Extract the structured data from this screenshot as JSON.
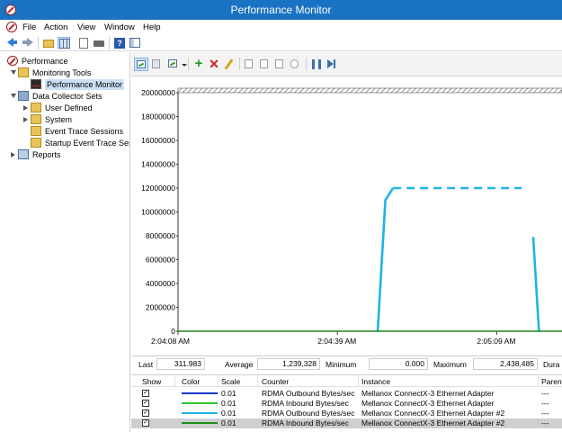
{
  "window": {
    "title": "Performance Monitor"
  },
  "menu": [
    "File",
    "Action",
    "View",
    "Window",
    "Help"
  ],
  "tree": {
    "root": "Performance",
    "monitoring_tools": "Monitoring Tools",
    "performance_monitor": "Performance Monitor",
    "data_collector_sets": "Data Collector Sets",
    "user_defined": "User Defined",
    "system": "System",
    "event_trace_sessions": "Event Trace Sessions",
    "startup_event_trace": "Startup Event Trace Ses",
    "reports": "Reports"
  },
  "chart_data": {
    "type": "line",
    "y_ticks": [
      "20000000",
      "18000000",
      "16000000",
      "14000000",
      "12000000",
      "10000000",
      "8000000",
      "6000000",
      "4000000",
      "2000000",
      "0"
    ],
    "ylim": [
      0,
      20000000
    ],
    "x_ticks": [
      "2:04:08 AM",
      "2:04:39 AM",
      "2:05:09 AM"
    ],
    "series": [
      {
        "name": "RDMA Inbound Bytes/sec",
        "color": "#1eb4e6",
        "style": "solid",
        "points": [
          [
            0.52,
            0
          ],
          [
            0.54,
            11000000
          ],
          [
            0.56,
            12000000
          ]
        ]
      },
      {
        "name": "RDMA Inbound Bytes/sec",
        "color": "#1eb4e6",
        "style": "dashed",
        "points": [
          [
            0.56,
            12000000
          ],
          [
            0.895,
            12000000
          ]
        ]
      },
      {
        "name": "RDMA Inbound Bytes/sec",
        "color": "#1eb4e6",
        "style": "solid",
        "points": [
          [
            0.925,
            7900000
          ],
          [
            0.94,
            0
          ]
        ]
      },
      {
        "name": "RDMA Inbound Bytes/sec #2",
        "color": "#1a8c1a",
        "style": "solid",
        "points": [
          [
            0,
            0
          ],
          [
            1,
            0
          ]
        ]
      }
    ]
  },
  "stats": {
    "last_label": "Last",
    "last_value": "311.983",
    "average_label": "Average",
    "average_value": "1,239,328",
    "minimum_label": "Minimum",
    "minimum_value": "0.000",
    "maximum_label": "Maximum",
    "maximum_value": "2,438,485",
    "duration_label": "Dura"
  },
  "legend": {
    "headers": {
      "show": "Show",
      "color": "Color",
      "scale": "Scale",
      "counter": "Counter",
      "instance": "Instance",
      "parent": "Parent"
    },
    "rows": [
      {
        "check": "✓",
        "color": "#1a35c8",
        "scale": "0.01",
        "counter": "RDMA Outbound Bytes/sec",
        "instance": "Mellanox ConnectX-3 Ethernet Adapter",
        "parent": "---"
      },
      {
        "check": "✓",
        "color": "#2ec82e",
        "scale": "0.01",
        "counter": "RDMA Inbound Bytes/sec",
        "instance": "Mellanox ConnectX-3 Ethernet Adapter",
        "parent": "---"
      },
      {
        "check": "✓",
        "color": "#1eb4e6",
        "scale": "0.01",
        "counter": "RDMA Outbound Bytes/sec",
        "instance": "Mellanox ConnectX-3 Ethernet Adapter #2",
        "parent": "---"
      },
      {
        "check": "✓",
        "color": "#1a8c1a",
        "scale": "0.01",
        "counter": "RDMA Inbound Bytes/sec",
        "instance": "Mellanox ConnectX-3 Ethernet Adapter #2",
        "parent": "---"
      }
    ]
  }
}
